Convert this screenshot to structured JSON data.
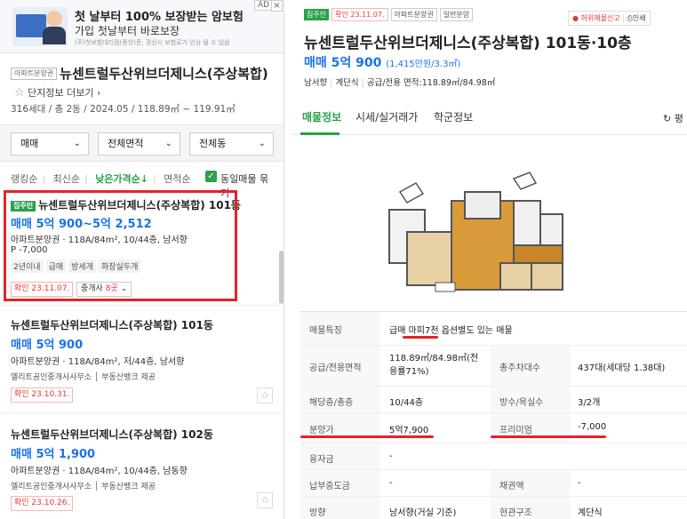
{
  "ad": {
    "title": "첫 날부터 100% 보장받는 암보험",
    "subtitle": "가입 첫날부터 바로보장",
    "note": "(주)첫보험대리점(중앙)준, 갱신시 보험료가 인상 될 수 있음",
    "badge": "AD",
    "close": "×"
  },
  "complex": {
    "type_tag": "아파트분양권",
    "name": "뉴센트럴두산위브더제니스(주상복합)",
    "info_link": "단지정보 더보기",
    "stats": "316세대 / 총 2동 / 2024.05 / 118.89㎡ ~ 119.91㎡"
  },
  "filters": {
    "trade": "매매",
    "area": "전체면적",
    "dong": "전체동"
  },
  "sort": {
    "options": [
      "랭킹순",
      "최신순",
      "낮은가격순↓",
      "면적순"
    ],
    "same_listing_label": "동일매물 묶기",
    "same_listing_checked": "✓"
  },
  "listings": [
    {
      "badge": "집주인",
      "name": "뉴센트럴두산위브더제니스(주상복합) 101동",
      "price": "매매 5억 900~5억 2,512",
      "meta": "아파트분양권 · 118A/84m², 10/44층, 남서향",
      "premium": "P -7,000",
      "tags": [
        "2년이내",
        "급매",
        "방세개",
        "화장실두개"
      ],
      "confirm": "확인 23.11.07.",
      "agent_prefix": "중개사",
      "agent_count": "8곳",
      "agent_chev": "⌄"
    },
    {
      "name": "뉴센트럴두산위브더제니스(주상복합) 101동",
      "price": "매매 5억 900",
      "meta": "아파트분양권 · 118A/84m², 저/44층, 남서향",
      "source": "엘리트공인중개사사무소 │ 부동산뱅크 제공",
      "confirm": "확인 23.10.31."
    },
    {
      "name": "뉴센트럴두산위브더제니스(주상복합) 102동",
      "price": "매매 5억 1,900",
      "meta": "아파트분양권 · 118A/84m², 10/44층, 남동향",
      "source": "엘리트공인중개사사무소 │ 부동산뱅크 제공",
      "confirm": "확인 23.10.26."
    }
  ],
  "detail": {
    "badges": [
      "집주인",
      "확인 23.11.07.",
      "아파트분양권",
      "일반분양"
    ],
    "report": "허위매물신고",
    "print": "인쇄",
    "title": "뉴센트럴두산위브더제니스(주상복합) 101동·10층",
    "price": "매매 5억 900",
    "price_per": "(1,415만원/3.3㎡)",
    "info": [
      "남서향",
      "계단식",
      "공급/전용 면적:118.89㎡/84.98㎡"
    ],
    "tabs": [
      "매물정보",
      "시세/실거래가",
      "학군정보"
    ],
    "refresh": "↻ 평"
  },
  "table": {
    "feature_key": "매물특징",
    "feature_val": "급매 마피7천 옵션별도 있는 매물",
    "area_key": "공급/전용면적",
    "area_val": "118.89㎡/84.98㎡(전용률71%)",
    "households_key": "총주차대수",
    "households_val": "437대(세대당 1.38대)",
    "floor_key": "해당층/총층",
    "floor_val": "10/44층",
    "rooms_key": "방수/욕실수",
    "rooms_val": "3/2개",
    "sale_price_key": "분양가",
    "sale_price_val": "5억7,900",
    "premium_key": "프리미엄",
    "premium_val": "-7,000",
    "loan_key": "융자금",
    "loan_val": "-",
    "paid_key": "납부중도금",
    "paid_val": "-",
    "right_key": "채권액",
    "right_val": "-",
    "dir_key": "방향",
    "dir_val": "남서향(거실 기준)",
    "struct_key": "현관구조",
    "struct_val": "계단식"
  },
  "icons": {
    "star": "☆"
  },
  "colors": {
    "accent_green": "#2ba04b",
    "price_blue": "#1a73e8",
    "highlight_red": "#e8212a"
  }
}
